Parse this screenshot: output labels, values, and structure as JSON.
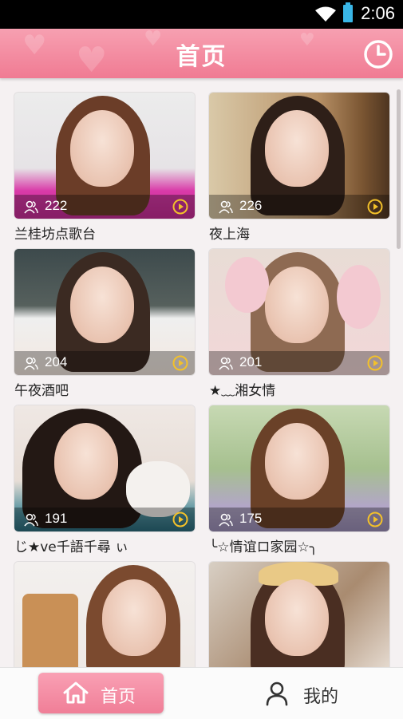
{
  "status_bar": {
    "time": "2:06"
  },
  "header": {
    "title": "首页"
  },
  "rooms": [
    {
      "name": "兰桂坊点歌台",
      "viewers": "222"
    },
    {
      "name": "夜上海",
      "viewers": "226"
    },
    {
      "name": "午夜酒吧",
      "viewers": "204"
    },
    {
      "name": "★﹏湘女情",
      "viewers": "201"
    },
    {
      "name": "じ★ve千語千尋 ぃ",
      "viewers": "191"
    },
    {
      "name": "╰☆情谊ロ家园☆╮",
      "viewers": "175"
    },
    {
      "name": "",
      "viewers": ""
    },
    {
      "name": "",
      "viewers": ""
    }
  ],
  "bottom_nav": {
    "home_label": "首页",
    "mine_label": "我的"
  },
  "colors": {
    "accent_pink": "#f07b93",
    "header_pink_light": "#f7a0b1",
    "play_yellow": "#f3c12a"
  }
}
